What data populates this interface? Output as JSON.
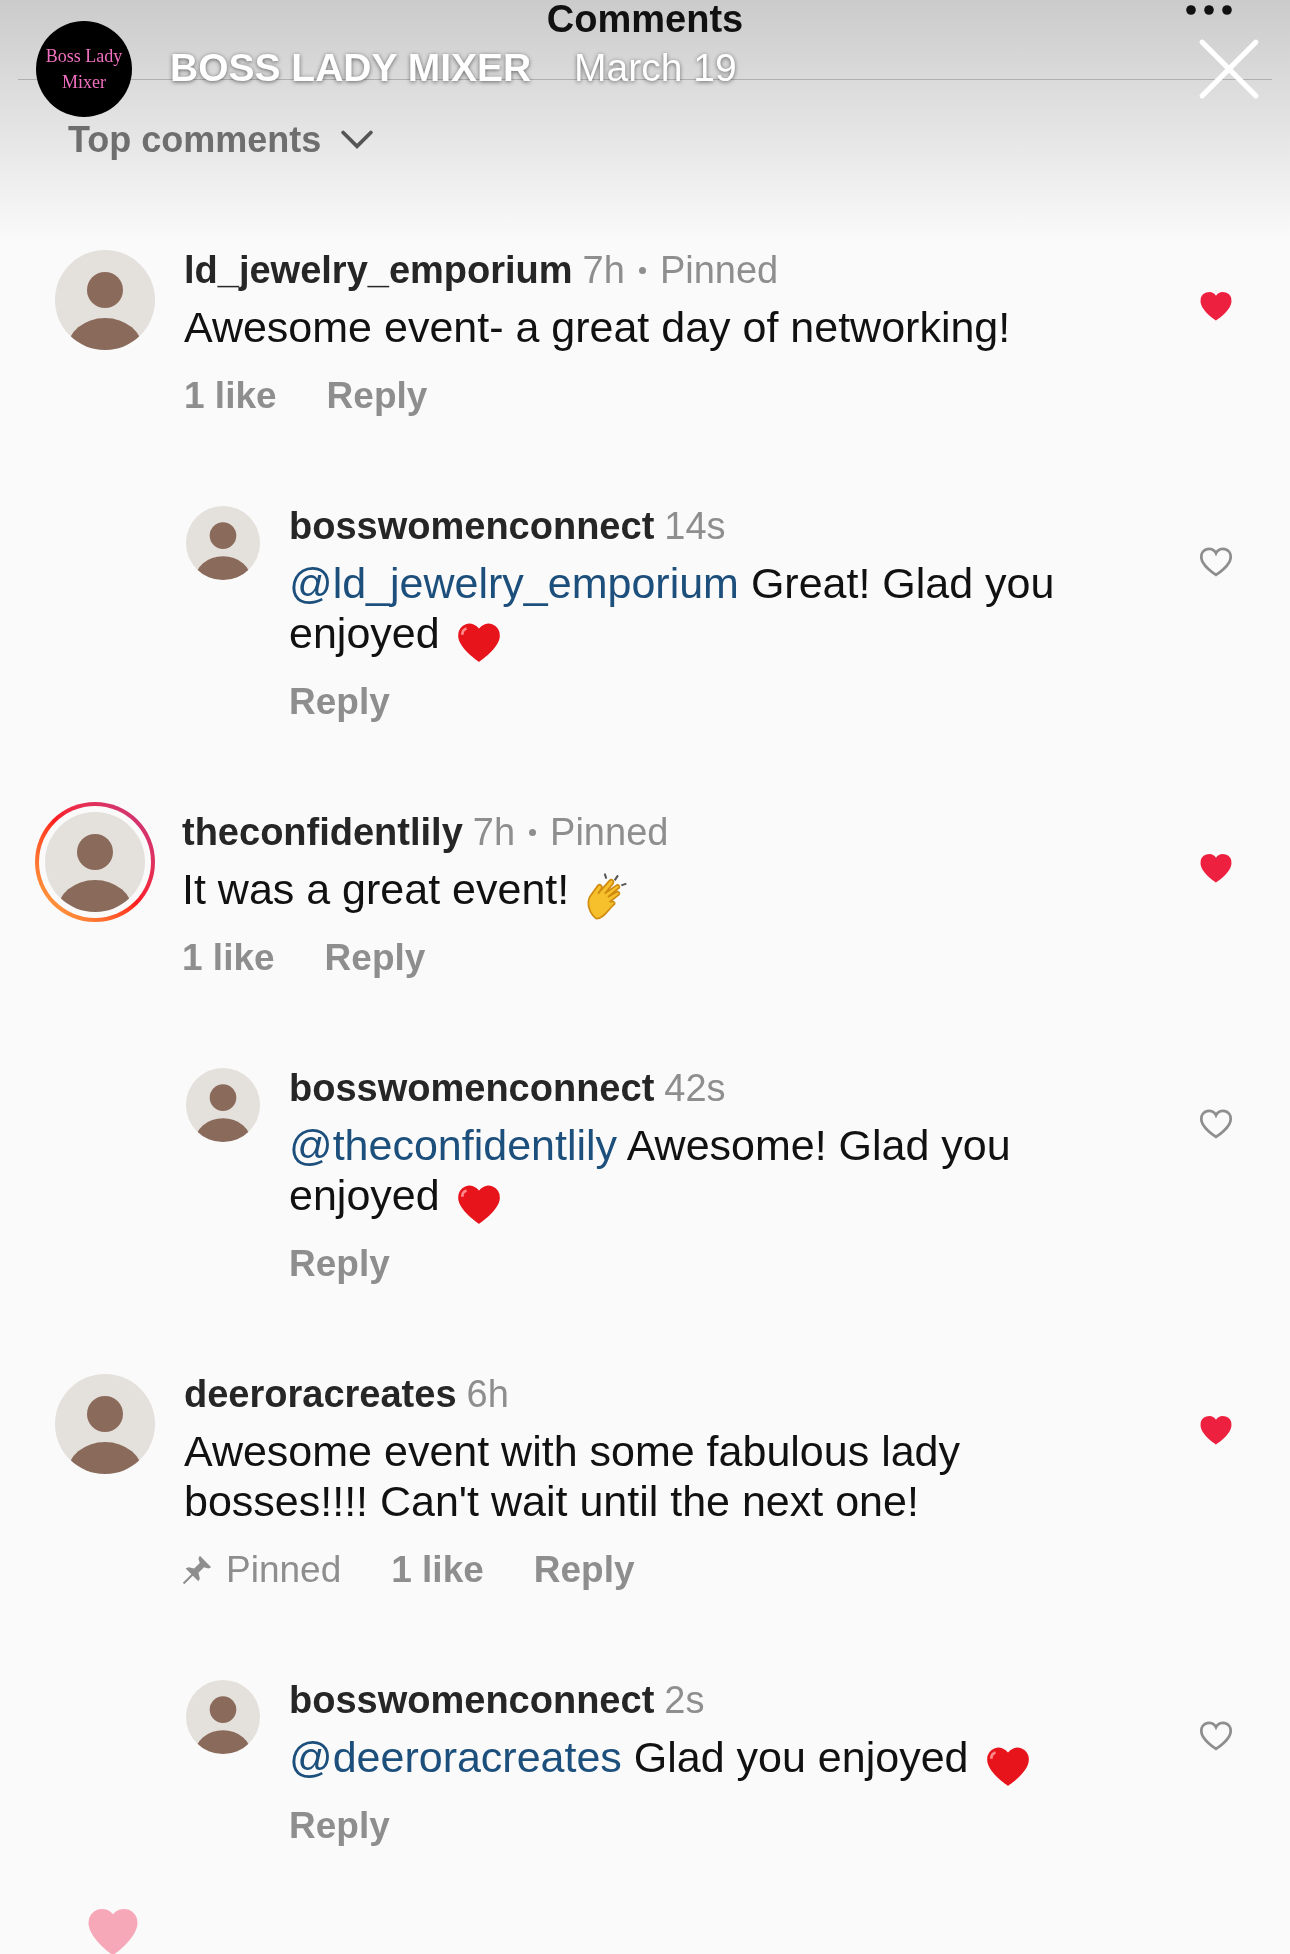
{
  "header": {
    "title": "Comments",
    "story": {
      "logo_text": "Boss Lady Mixer",
      "account": "BOSS LADY MIXER",
      "date": "March 19"
    },
    "sort": {
      "label": "Top comments"
    }
  },
  "comments": [
    {
      "username": "ld_jewelry_emporium",
      "time": "7h",
      "avatar": {
        "story_ring": false
      },
      "pinned": {
        "kind": "header",
        "label": "Pinned"
      },
      "text": "Awesome event- a great day of networking!",
      "likes": "1 like",
      "reply_label": "Reply",
      "liked": true,
      "replies": [
        {
          "username": "bosswomenconnect",
          "time": "14s",
          "avatar": {
            "story_ring": false
          },
          "mention": "@ld_jewelry_emporium",
          "text": "Great! Glad you enjoyed",
          "emoji": {
            "kind": "heart"
          },
          "reply_label": "Reply",
          "liked": false
        }
      ]
    },
    {
      "username": "theconfidentlily",
      "time": "7h",
      "avatar": {
        "story_ring": true
      },
      "pinned": {
        "kind": "header",
        "label": "Pinned"
      },
      "text": "It was a great event!",
      "emoji": {
        "kind": "clap"
      },
      "likes": "1 like",
      "reply_label": "Reply",
      "liked": true,
      "replies": [
        {
          "username": "bosswomenconnect",
          "time": "42s",
          "avatar": {
            "story_ring": false
          },
          "mention": "@theconfidentlily",
          "text": "Awesome! Glad you enjoyed",
          "emoji": {
            "kind": "heart"
          },
          "reply_label": "Reply",
          "liked": false
        }
      ]
    },
    {
      "username": "deeroracreates",
      "time": "6h",
      "avatar": {
        "story_ring": false
      },
      "pinned": {
        "kind": "actions",
        "label": "Pinned"
      },
      "text": "Awesome event with some fabulous lady bosses!!!! Can't wait until the next one!",
      "likes": "1 like",
      "reply_label": "Reply",
      "liked": true,
      "replies": [
        {
          "username": "bosswomenconnect",
          "time": "2s",
          "avatar": {
            "story_ring": false
          },
          "mention": "@deeroracreates",
          "text": "Glad you enjoyed",
          "emoji": {
            "kind": "heart"
          },
          "reply_label": "Reply",
          "liked": false
        }
      ]
    }
  ]
}
